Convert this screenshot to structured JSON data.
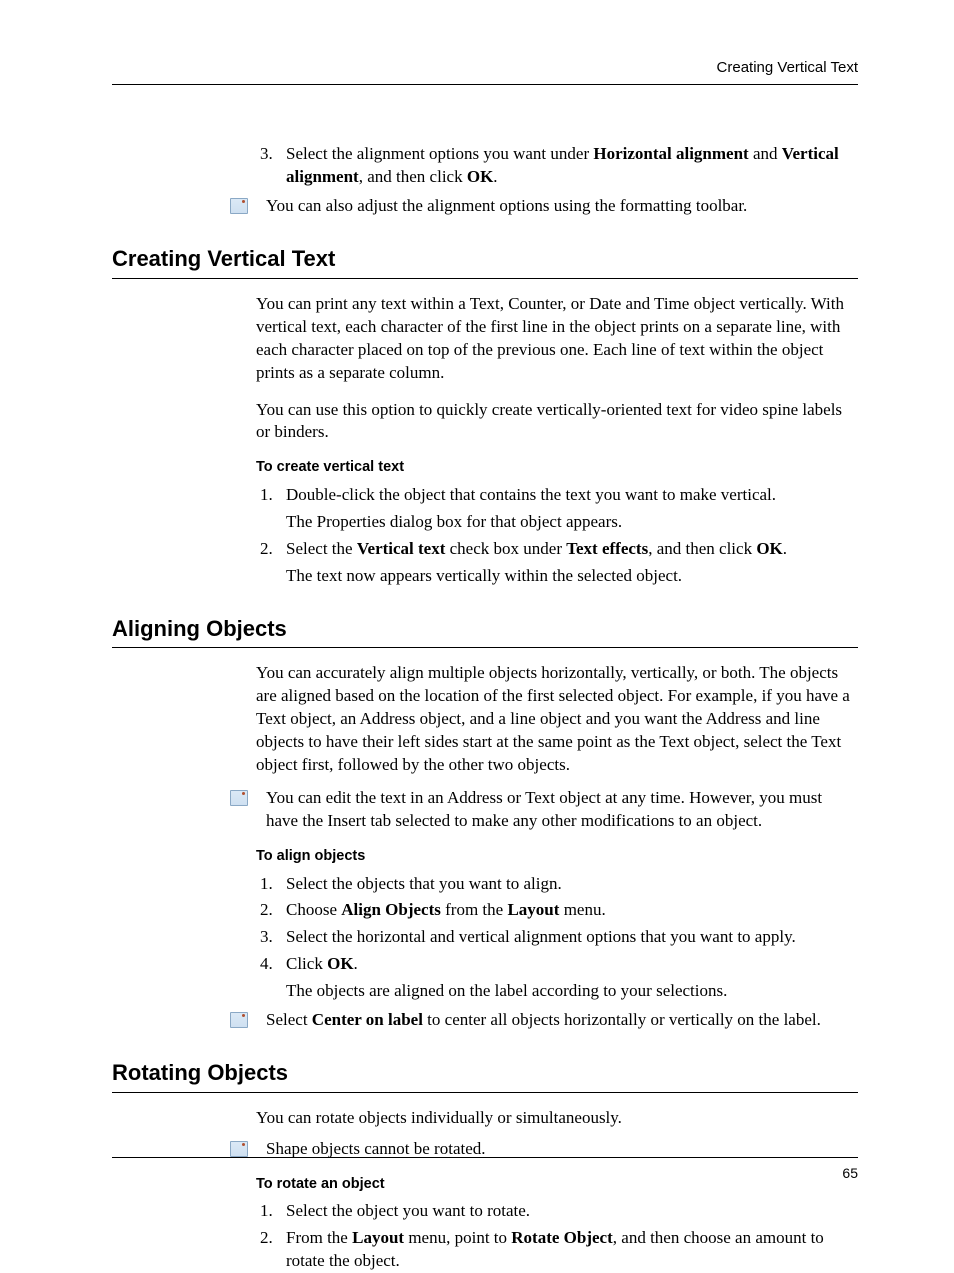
{
  "header": {
    "running_title": "Creating Vertical Text"
  },
  "intro_continuation": {
    "step3_pre": "Select the alignment options you want under ",
    "step3_b1": "Horizontal alignment",
    "step3_mid1": " and ",
    "step3_b2": "Vertical alignment",
    "step3_mid2": ", and then click ",
    "step3_b3": "OK",
    "step3_post": ".",
    "note": "You can also adjust the alignment options using the formatting toolbar."
  },
  "section1": {
    "title": "Creating Vertical Text",
    "p1": "You can print any text within a Text, Counter, or Date and Time object vertically. With vertical text, each character of the first line in the object prints on a separate line, with each character placed on top of the previous one. Each line of text within the object prints as a separate column.",
    "p2": "You can use this option to quickly create vertically-oriented text for video spine labels or binders.",
    "subhead": "To create vertical text",
    "s1": "Double-click the object that contains the text you want to make vertical.",
    "s1_sub": "The Properties dialog box for that object appears.",
    "s2_pre": "Select the ",
    "s2_b1": "Vertical text",
    "s2_mid1": " check box under ",
    "s2_b2": "Text effects",
    "s2_mid2": ", and then click ",
    "s2_b3": "OK",
    "s2_post": ".",
    "s2_sub": "The text now appears vertically within the selected object."
  },
  "section2": {
    "title": "Aligning Objects",
    "p1": "You can accurately align multiple objects horizontally, vertically, or both. The objects are aligned based on the location of the first selected object. For example, if you have a Text object, an Address object, and a line object and you want the Address and line objects to have their left sides start at the same point as the Text object, select the Text object first, followed by the other two objects.",
    "note": "You can edit the text in an Address or Text object at any time. However, you must have the Insert tab selected to make any other modifications to an object.",
    "subhead": "To align objects",
    "s1": "Select the objects that you want to align.",
    "s2_pre": "Choose ",
    "s2_b1": "Align Objects",
    "s2_mid": " from the ",
    "s2_b2": "Layout",
    "s2_post": " menu.",
    "s3": "Select the horizontal and vertical alignment options that you want to apply.",
    "s4_pre": "Click ",
    "s4_b1": "OK",
    "s4_post": ".",
    "s4_sub": "The objects are aligned on the label according to your selections.",
    "note2_pre": "Select ",
    "note2_b1": "Center on label",
    "note2_post": " to center all objects horizontally or vertically on the label."
  },
  "section3": {
    "title": "Rotating Objects",
    "p1": "You can rotate objects individually or simultaneously.",
    "note": "Shape objects cannot be rotated.",
    "subhead": "To rotate an object",
    "s1": "Select the object you want to rotate.",
    "s2_pre": "From the ",
    "s2_b1": "Layout",
    "s2_mid1": " menu, point to ",
    "s2_b2": "Rotate Object",
    "s2_post": ", and then choose an amount to rotate the object."
  },
  "footer": {
    "page_number": "65"
  }
}
